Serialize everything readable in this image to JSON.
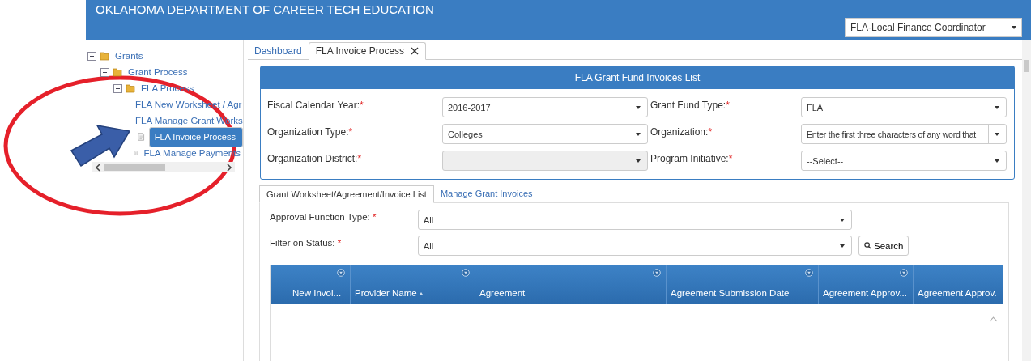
{
  "header": {
    "title": "OKLAHOMA DEPARTMENT OF CAREER TECH EDUCATION",
    "role_select": {
      "value": "FLA-Local Finance Coordinator"
    }
  },
  "tree": [
    {
      "label": "Grants",
      "kind": "folder",
      "expanded": true,
      "selected": false,
      "children": [
        {
          "label": "Grant Process",
          "kind": "folder",
          "expanded": true,
          "selected": false,
          "children": [
            {
              "label": "FLA Process",
              "kind": "folder",
              "expanded": true,
              "selected": false,
              "children": [
                {
                  "label": "FLA New Worksheet / Agr",
                  "kind": "page",
                  "selected": false
                },
                {
                  "label": "FLA Manage Grant Works",
                  "kind": "page",
                  "selected": false
                },
                {
                  "label": "FLA Invoice Process",
                  "kind": "page",
                  "selected": true
                },
                {
                  "label": "FLA Manage Payments",
                  "kind": "page",
                  "selected": false
                }
              ]
            }
          ]
        }
      ]
    }
  ],
  "tabs": [
    {
      "label": "Dashboard",
      "selected": false,
      "closable": false
    },
    {
      "label": "FLA Invoice Process",
      "selected": true,
      "closable": true
    }
  ],
  "panel": {
    "title": "FLA Grant Fund Invoices List",
    "fields": [
      {
        "label": "Fiscal Calendar Year:",
        "required_mark": "*",
        "value": "2016-2017",
        "disabled": false
      },
      {
        "label": "Grant Fund Type:",
        "required_mark": "*",
        "value": "FLA",
        "disabled": false
      },
      {
        "label": "Organization Type:",
        "required_mark": "*",
        "value": "Colleges",
        "disabled": false
      },
      {
        "label": "Organization:",
        "required_mark": "*",
        "placeholder": "Enter the first three characters of any word that",
        "disabled": false
      },
      {
        "label": "Organization District:",
        "required_mark": "*",
        "disabled": true
      },
      {
        "label": "Program Initiative:",
        "required_mark": "*",
        "value": "--Select--",
        "disabled": false
      }
    ]
  },
  "subtabs": [
    {
      "label": "Grant Worksheet/Agreement/Invoice List",
      "selected": true
    },
    {
      "label": "Manage Grant Invoices",
      "selected": false
    }
  ],
  "filters": [
    {
      "label": "Approval Function Type:",
      "required_mark": "*",
      "value": "All"
    },
    {
      "label": "Filter on Status:",
      "required_mark": "*",
      "value": "All"
    }
  ],
  "search_button": "Search",
  "table": {
    "columns": [
      {
        "label": "New Invoi...",
        "filter": true,
        "sorted": false
      },
      {
        "label": "Provider Name",
        "filter": true,
        "sorted": true
      },
      {
        "label": "Agreement",
        "filter": true,
        "sorted": false
      },
      {
        "label": "Agreement Submission Date",
        "filter": true,
        "sorted": false
      },
      {
        "label": "Agreement Approv...",
        "filter": true,
        "sorted": false
      },
      {
        "label": "Agreement Approv.",
        "filter": false,
        "sorted": false
      }
    ]
  }
}
